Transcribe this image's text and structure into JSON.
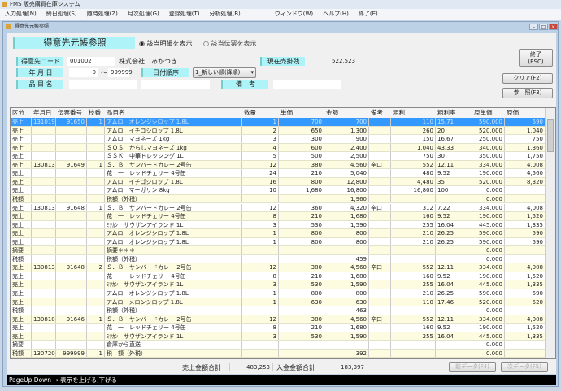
{
  "app_title": "FMS 販売購買在庫システム",
  "menu": [
    "入力処理(N)",
    "締日処理(S)",
    "随時処理(Z)",
    "月次処理(G)",
    "登録処理(T)",
    "分析処理(B)",
    "ウィンドウ(W)",
    "ヘルプ(H)",
    "終了(E)"
  ],
  "child_title": "得意先元帳参照",
  "form": {
    "heading": "得意先元帳参照",
    "radio_detail": "該当明細を表示",
    "radio_slip": "該当伝票を表示",
    "customer_code_label": "得意先コード",
    "customer_code": "001002",
    "customer_name": "株式会社　あかつき",
    "balance_label": "現在売掛残",
    "balance": "522,523",
    "date_label": "年 月 日",
    "date_from": "0",
    "tilde": "～",
    "date_to": "999999",
    "order_label": "日付順序",
    "order_value": "1_新しい順(降順)",
    "item_label": "品 目 名",
    "remarks_label": "備　考"
  },
  "buttons": {
    "exit": "終了\n(ESC)",
    "clear": "クリア(F2)",
    "browse": "参　照(F3)",
    "prev": "前データ(F4)",
    "next": "次データ(F5)"
  },
  "columns": [
    "区分",
    "年月日",
    "伝票番号",
    "枝番",
    "品目名",
    "数量",
    "単価",
    "金額",
    "備考",
    "粗利",
    "粗利率",
    "原単価",
    "原価"
  ],
  "rows": [
    [
      "売上",
      "131019",
      "91650",
      "1",
      "アムロ　オレンジシロップ 1.8L",
      "1",
      "700",
      "700",
      "",
      "110",
      "15.71",
      "590.000",
      "590"
    ],
    [
      "売上",
      "",
      "",
      "",
      "アムロ　イチゴシロップ 1.8L",
      "2",
      "650",
      "1,300",
      "",
      "260",
      "20",
      "520.000",
      "1,040"
    ],
    [
      "売上",
      "",
      "",
      "",
      "アムロ　マヨネーズ 1kg",
      "3",
      "300",
      "900",
      "",
      "150",
      "16.67",
      "250.000",
      "750"
    ],
    [
      "売上",
      "",
      "",
      "",
      "ＳＯＳ　からしマヨネーズ 1kg",
      "4",
      "600",
      "2,400",
      "",
      "1,040",
      "43.33",
      "340.000",
      "1,360"
    ],
    [
      "売上",
      "",
      "",
      "",
      "ＳＳＫ　中華ドレッシング 1L",
      "5",
      "500",
      "2,500",
      "",
      "750",
      "30",
      "350.000",
      "1,750"
    ],
    [
      "売上",
      "130813",
      "91649",
      "1",
      "Ｓ．Ｂ　サンバードカレー 2号缶",
      "12",
      "380",
      "4,560",
      "辛口",
      "552",
      "12.11",
      "334.000",
      "4,008"
    ],
    [
      "売上",
      "",
      "",
      "",
      "花　一　レッドチェリー 4号缶",
      "24",
      "210",
      "5,040",
      "",
      "480",
      "9.52",
      "190.000",
      "4,560"
    ],
    [
      "売上",
      "",
      "",
      "",
      "アムロ　イチゴシロップ 1.8L",
      "16",
      "800",
      "12,800",
      "",
      "4,480",
      "35",
      "520.000",
      "8,320"
    ],
    [
      "売上",
      "",
      "",
      "",
      "アムロ　マーガリン 8kg",
      "10",
      "1,680",
      "16,800",
      "",
      "16,800",
      "100",
      "0.000",
      ""
    ],
    [
      "税額",
      "",
      "",
      "",
      "税額（外税）",
      "",
      "",
      "1,960",
      "",
      "",
      "",
      "0.000",
      ""
    ],
    [
      "売上",
      "130813",
      "91648",
      "1",
      "Ｓ．Ｂ　サンバードカレー 2号缶",
      "12",
      "360",
      "4,320",
      "辛口",
      "312",
      "7.22",
      "334.000",
      "4,008"
    ],
    [
      "売上",
      "",
      "",
      "",
      "花　一　レッドチェリー 4号缶",
      "8",
      "210",
      "1,680",
      "",
      "160",
      "9.52",
      "190.000",
      "1,520"
    ],
    [
      "売上",
      "",
      "",
      "",
      "ﾐﾂｶﾝ　サウザンアイランド 1L",
      "3",
      "530",
      "1,590",
      "",
      "255",
      "16.04",
      "445.000",
      "1,335"
    ],
    [
      "売上",
      "",
      "",
      "",
      "アムロ　オレンジシロップ 1.8L",
      "1",
      "800",
      "800",
      "",
      "210",
      "26.25",
      "590.000",
      "590"
    ],
    [
      "売上",
      "",
      "",
      "",
      "アムロ　オレンジシロップ 1.8L",
      "1",
      "800",
      "800",
      "",
      "210",
      "26.25",
      "590.000",
      "590"
    ],
    [
      "摘要",
      "",
      "",
      "",
      "摘要＊＊＊",
      "",
      "",
      "",
      "",
      "",
      "",
      "0.000",
      ""
    ],
    [
      "税額",
      "",
      "",
      "",
      "税額（外税）",
      "",
      "",
      "459",
      "",
      "",
      "",
      "0.000",
      ""
    ],
    [
      "売上",
      "130813",
      "91648",
      "2",
      "Ｓ．Ｂ　サンバードカレー 2号缶",
      "12",
      "380",
      "4,560",
      "辛口",
      "552",
      "12.11",
      "334.000",
      "4,008"
    ],
    [
      "売上",
      "",
      "",
      "",
      "花　一　レッドチェリー 4号缶",
      "8",
      "210",
      "1,680",
      "",
      "160",
      "9.52",
      "190.000",
      "1,520"
    ],
    [
      "売上",
      "",
      "",
      "",
      "ﾐﾂｶﾝ　サウザンアイランド 1L",
      "3",
      "530",
      "1,590",
      "",
      "255",
      "16.04",
      "445.000",
      "1,335"
    ],
    [
      "売上",
      "",
      "",
      "",
      "アムロ　オレンジシロップ 1.8L",
      "1",
      "800",
      "800",
      "",
      "210",
      "26.25",
      "590.000",
      "590"
    ],
    [
      "売上",
      "",
      "",
      "",
      "アムロ　メロンシロップ 1.8L",
      "1",
      "630",
      "630",
      "",
      "110",
      "17.46",
      "520.000",
      "520"
    ],
    [
      "税額",
      "",
      "",
      "",
      "税額（外税）",
      "",
      "",
      "463",
      "",
      "",
      "",
      "0.000",
      ""
    ],
    [
      "売上",
      "130810",
      "91646",
      "1",
      "Ｓ．Ｂ　サンバードカレー 2号缶",
      "12",
      "380",
      "4,560",
      "辛口",
      "552",
      "12.11",
      "334.000",
      "4,008"
    ],
    [
      "売上",
      "",
      "",
      "",
      "花　一　レッドチェリー 4号缶",
      "8",
      "210",
      "1,680",
      "",
      "160",
      "9.52",
      "190.000",
      "1,520"
    ],
    [
      "売上",
      "",
      "",
      "",
      "ﾐﾂｶﾝ　サウザンアイランド 1L",
      "3",
      "530",
      "1,590",
      "",
      "255",
      "16.04",
      "445.000",
      "1,335"
    ],
    [
      "摘要",
      "",
      "",
      "",
      "倉庫から直送",
      "",
      "",
      "",
      "",
      "",
      "",
      "0.000",
      ""
    ],
    [
      "税額",
      "130720",
      "999999",
      "1",
      "税　額（外税）",
      "",
      "",
      "392",
      "",
      "",
      "",
      "0.000",
      ""
    ]
  ],
  "totals": {
    "sales_label": "売上金額合計",
    "sales": "483,253",
    "receipt_label": "入金金額合計",
    "receipt": "183,397"
  },
  "status": "PageUp,Down → 表示を上げる,下げる"
}
